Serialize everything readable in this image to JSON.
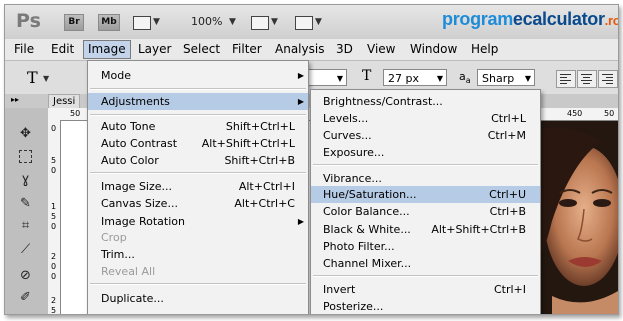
{
  "appbar": {
    "logo": "Ps",
    "bridge_label": "Br",
    "minibridge_label": "Mb",
    "zoom": "100%"
  },
  "brand": {
    "part1": "program",
    "part2": "ecalculator",
    "part3": ".ro"
  },
  "menubar": [
    "File",
    "Edit",
    "Image",
    "Layer",
    "Select",
    "Filter",
    "Analysis",
    "3D",
    "View",
    "Window",
    "Help"
  ],
  "options": {
    "font_size": "27 px",
    "aa_icon_label": "a",
    "antialias": "Sharp"
  },
  "document_tab": "Jessi",
  "rulers": {
    "top": [
      "50",
      "0",
      "450",
      "50"
    ],
    "left": [
      "0",
      "5",
      "0",
      "1",
      "5",
      "0",
      "2",
      "0",
      "0",
      "2",
      "5"
    ]
  },
  "image_menu": {
    "items": [
      {
        "label": "Mode",
        "shortcut": "",
        "submenu": true,
        "state": "normal"
      },
      {
        "label": "Adjustments",
        "shortcut": "",
        "submenu": true,
        "state": "highlighted"
      },
      {
        "label": "Auto Tone",
        "shortcut": "Shift+Ctrl+L",
        "submenu": false,
        "state": "normal"
      },
      {
        "label": "Auto Contrast",
        "shortcut": "Alt+Shift+Ctrl+L",
        "submenu": false,
        "state": "normal"
      },
      {
        "label": "Auto Color",
        "shortcut": "Shift+Ctrl+B",
        "submenu": false,
        "state": "normal"
      },
      {
        "label": "Image Size...",
        "shortcut": "Alt+Ctrl+I",
        "submenu": false,
        "state": "normal"
      },
      {
        "label": "Canvas Size...",
        "shortcut": "Alt+Ctrl+C",
        "submenu": false,
        "state": "normal"
      },
      {
        "label": "Image Rotation",
        "shortcut": "",
        "submenu": true,
        "state": "normal"
      },
      {
        "label": "Crop",
        "shortcut": "",
        "submenu": false,
        "state": "disabled"
      },
      {
        "label": "Trim...",
        "shortcut": "",
        "submenu": false,
        "state": "normal"
      },
      {
        "label": "Reveal All",
        "shortcut": "",
        "submenu": false,
        "state": "disabled"
      },
      {
        "label": "Duplicate...",
        "shortcut": "",
        "submenu": false,
        "state": "normal"
      }
    ]
  },
  "adjustments_menu": {
    "items": [
      {
        "label": "Brightness/Contrast...",
        "shortcut": "",
        "state": "normal"
      },
      {
        "label": "Levels...",
        "shortcut": "Ctrl+L",
        "state": "normal"
      },
      {
        "label": "Curves...",
        "shortcut": "Ctrl+M",
        "state": "normal"
      },
      {
        "label": "Exposure...",
        "shortcut": "",
        "state": "normal"
      },
      {
        "label": "Vibrance...",
        "shortcut": "",
        "state": "normal"
      },
      {
        "label": "Hue/Saturation...",
        "shortcut": "Ctrl+U",
        "state": "highlighted"
      },
      {
        "label": "Color Balance...",
        "shortcut": "Ctrl+B",
        "state": "normal"
      },
      {
        "label": "Black & White...",
        "shortcut": "Alt+Shift+Ctrl+B",
        "state": "normal"
      },
      {
        "label": "Photo Filter...",
        "shortcut": "",
        "state": "normal"
      },
      {
        "label": "Channel Mixer...",
        "shortcut": "",
        "state": "normal"
      },
      {
        "label": "Invert",
        "shortcut": "Ctrl+I",
        "state": "normal"
      },
      {
        "label": "Posterize...",
        "shortcut": "",
        "state": "normal"
      }
    ]
  },
  "colors": {
    "highlight": "#b6cbe6",
    "menu_bg": "#f2f2f2",
    "brand_blue": "#1e8cd8",
    "brand_orange": "#e05a10"
  }
}
